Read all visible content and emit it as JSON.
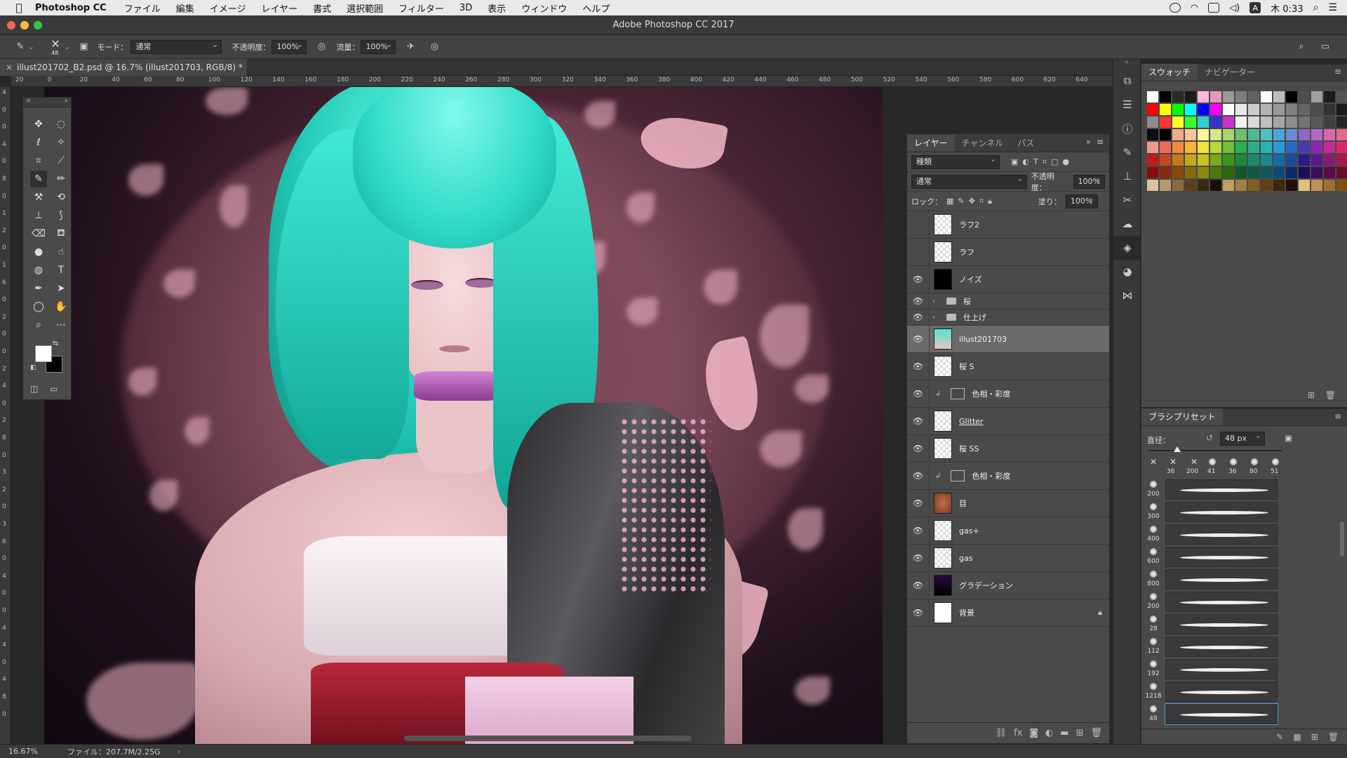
{
  "menubar": {
    "app_name": "Photoshop CC",
    "items": [
      "ファイル",
      "編集",
      "イメージ",
      "レイヤー",
      "書式",
      "選択範囲",
      "フィルター",
      "3D",
      "表示",
      "ウィンドウ",
      "ヘルプ"
    ],
    "clock": "木 0:33",
    "input_indicator": "A"
  },
  "window": {
    "title": "Adobe Photoshop CC 2017"
  },
  "options_bar": {
    "brush_size": "48",
    "mode_label": "モード：",
    "mode_value": "通常",
    "opacity_label": "不透明度：",
    "opacity_value": "100%",
    "flow_label": "流量：",
    "flow_value": "100%"
  },
  "document": {
    "tab_title": "illust201702_B2.psd @ 16.7% (illust201703, RGB/8) *",
    "h_ruler_labels": [
      "20",
      "0",
      "20",
      "40",
      "60",
      "80",
      "100",
      "120",
      "140",
      "160",
      "180",
      "200",
      "220",
      "240",
      "260",
      "280",
      "300",
      "320",
      "340",
      "360",
      "380",
      "400",
      "420",
      "440",
      "460",
      "480",
      "500",
      "520",
      "540",
      "560",
      "580",
      "600",
      "620",
      "640"
    ],
    "v_ruler_labels": [
      "4",
      "0",
      "0",
      "4",
      "0",
      "8",
      "0",
      "1",
      "2",
      "0",
      "1",
      "6",
      "0",
      "2",
      "0",
      "0",
      "2",
      "4",
      "0",
      "2",
      "8",
      "0",
      "3",
      "2",
      "0",
      "3",
      "6",
      "0",
      "4",
      "0",
      "0",
      "4",
      "4",
      "0",
      "4",
      "8",
      "0"
    ]
  },
  "layers_panel": {
    "tabs": [
      "レイヤー",
      "チャンネル",
      "パス"
    ],
    "filter_label": "種類",
    "blend_mode": "通常",
    "opacity_label": "不透明度：",
    "opacity_value": "100%",
    "lock_label": "ロック：",
    "fill_label": "塗り：",
    "fill_value": "100%",
    "layers": [
      {
        "name": "ラフ2",
        "visible": false,
        "kind": "pixel"
      },
      {
        "name": "ラフ",
        "visible": false,
        "kind": "pixel"
      },
      {
        "name": "ノイズ",
        "visible": true,
        "kind": "pixel"
      },
      {
        "name": "桜",
        "visible": true,
        "kind": "group"
      },
      {
        "name": "仕上げ",
        "visible": true,
        "kind": "group"
      },
      {
        "name": "illust201703",
        "visible": true,
        "kind": "pixel",
        "selected": true
      },
      {
        "name": "桜 S",
        "visible": true,
        "kind": "pixel"
      },
      {
        "name": "色相・彩度",
        "visible": true,
        "kind": "adjustment"
      },
      {
        "name": "Glitter",
        "visible": true,
        "kind": "pixel"
      },
      {
        "name": "桜 SS",
        "visible": true,
        "kind": "pixel"
      },
      {
        "name": "色相・彩度",
        "visible": true,
        "kind": "adjustment"
      },
      {
        "name": "目",
        "visible": true,
        "kind": "pixel"
      },
      {
        "name": "gas+",
        "visible": true,
        "kind": "pixel"
      },
      {
        "name": "gas",
        "visible": true,
        "kind": "pixel"
      },
      {
        "name": "グラデーション",
        "visible": true,
        "kind": "pixel"
      },
      {
        "name": "背景",
        "visible": true,
        "kind": "pixel",
        "locked": true
      }
    ]
  },
  "swatches_panel": {
    "tabs": [
      "スウォッチ",
      "ナビゲーター"
    ],
    "colors": [
      "#ffffff",
      "#000000",
      "#2a2a2a",
      "#1a1a1a",
      "#f7b9d5",
      "#e997c2",
      "#9a9a9a",
      "#7d7d7d",
      "#626262",
      "#ffffff",
      "#bdbdbd",
      "#000000",
      "#4f4f4f",
      "#a0a0a0",
      "#1d1d1d",
      "#555555",
      "#ff0000",
      "#ffff00",
      "#00ff00",
      "#00ffff",
      "#0000ff",
      "#ff00ff",
      "#ffffff",
      "#e6e6e6",
      "#cccccc",
      "#b3b3b3",
      "#999999",
      "#808080",
      "#666666",
      "#4d4d4d",
      "#333333",
      "#1a1a1a",
      "#8c8c8c",
      "#ff3333",
      "#ffff33",
      "#33ff33",
      "#33cccc",
      "#3333cc",
      "#cc33cc",
      "#f2f2f2",
      "#d9d9d9",
      "#bfbfbf",
      "#a6a6a6",
      "#8c8c8c",
      "#737373",
      "#595959",
      "#404040",
      "#262626",
      "#0d0d0d",
      "#000000",
      "#f4a98b",
      "#f8c39a",
      "#fff59d",
      "#d4e88c",
      "#a5d86f",
      "#6cc06f",
      "#4fb890",
      "#4fc0c0",
      "#4aa6d8",
      "#6b8ad0",
      "#8c6ac4",
      "#b36ac4",
      "#d46aa6",
      "#e56a8a",
      "#f0998a",
      "#ee6a5a",
      "#f28a3a",
      "#f6b63a",
      "#f2e23a",
      "#b7d83a",
      "#6cc23a",
      "#2ab04a",
      "#2ab08a",
      "#2ab2b2",
      "#2a9ad6",
      "#2a6ac4",
      "#4a3ab0",
      "#8a2ab0",
      "#c42a9a",
      "#d82a6a",
      "#c41a1a",
      "#c4481a",
      "#c47a1a",
      "#c4aa1a",
      "#c4c41a",
      "#7aa81a",
      "#3a981a",
      "#1a8a3a",
      "#1a8a6a",
      "#1a8a8a",
      "#1a6aa8",
      "#1a4a98",
      "#2a1a8a",
      "#5a1a8a",
      "#8a1a7a",
      "#a81a4a",
      "#8a0d0d",
      "#8a2a0d",
      "#8a4a0d",
      "#8a6a0d",
      "#8a8a0d",
      "#4a7a0d",
      "#2a6a0d",
      "#0d5a2a",
      "#0d5a4a",
      "#0d5a5a",
      "#0d4a7a",
      "#0d2a6a",
      "#1a0d5a",
      "#3a0d5a",
      "#5a0d4a",
      "#6a0d2a",
      "#d9c4a0",
      "#b89a6a",
      "#8a6a40",
      "#5a4020",
      "#3a2810",
      "#1a1008",
      "#c0a060",
      "#a08040",
      "#806020",
      "#604010",
      "#402808",
      "#201004",
      "#e0c080",
      "#c09050",
      "#a07030",
      "#805010"
    ]
  },
  "brush_panel": {
    "title": "ブラシプリセット",
    "size_label": "直径：",
    "size_value": "48 px",
    "top_sizes": [
      "36",
      "200",
      "41",
      "36",
      "80",
      "51"
    ],
    "presets": [
      "200",
      "300",
      "400",
      "600",
      "800",
      "200",
      "28",
      "112",
      "192",
      "1218",
      "48"
    ]
  },
  "status_bar": {
    "zoom": "16.67%",
    "file_info": "ファイル：207.7M/2.25G"
  }
}
